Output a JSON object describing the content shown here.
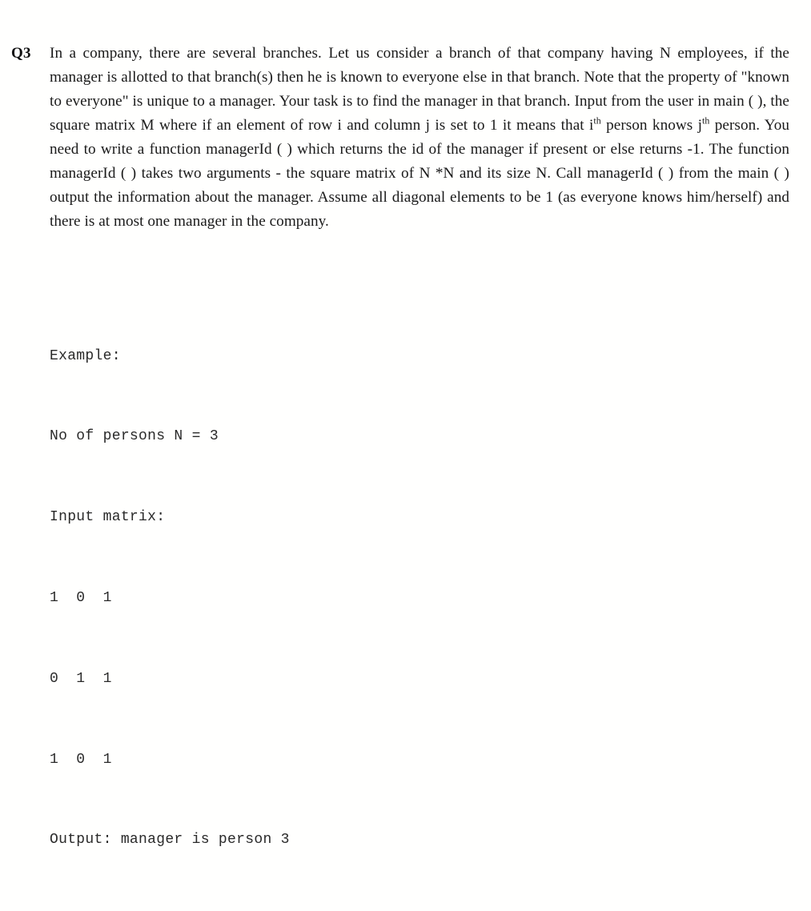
{
  "document": {
    "background_color": "#fffffe",
    "text_color": "#1a1a1a"
  },
  "question": {
    "label": "Q3",
    "paragraph_prefix": "In a company, there are several branches. Let us consider a branch of that company having N employees, if the manager is allotted to that branch(s) then he is known to everyone else in that branch. Note that the property of \"known to everyone\" is unique to a manager. Your task is to find the manager in that branch. Input from the user in main ( ), the square matrix M where if an element of row i and column j is set to 1 it means that i",
    "sup_1": "th",
    "paragraph_mid": " person knows j",
    "sup_2": "th",
    "paragraph_suffix": " person. You need to write a function managerId ( ) which returns the id of the manager if present or else returns -1. The function managerId ( ) takes two arguments - the square matrix of N *N and its size N. Call managerId ( ) from the main ( ) output the information about the manager. Assume all diagonal elements to be 1 (as everyone knows him/herself) and there is at most one manager in the company.",
    "full_text_plain": "In a company, there are several branches. Let us consider a branch of that company having N employees, if the manager is allotted to that branch(s) then he is known to everyone else in that branch. Note that the property of \"known to everyone\" is unique to a manager. Your task is to find the manager in that branch. Input from the user in main ( ), the square matrix M where if an element of row i and column j is set to 1 it means that ith person knows jth person. You need to write a function managerId ( ) which returns the id of the manager if present or else returns -1. The function managerId ( ) takes two arguments - the square matrix of N *N and its size N. Call managerId ( ) from the main ( ) output the information about the manager. Assume all diagonal elements to be 1 (as everyone knows him/herself) and there is at most one manager in the company."
  },
  "example": {
    "heading": "Example:",
    "persons_line": "No of persons N = 3",
    "matrix_heading": "Input matrix:",
    "matrix_rows": [
      "1  0  1",
      "0  1  1",
      "1  0  1"
    ],
    "matrix_values": [
      [
        1,
        0,
        1
      ],
      [
        0,
        1,
        1
      ],
      [
        1,
        0,
        1
      ]
    ],
    "n": 3,
    "output_line": "Output: manager is person 3"
  }
}
